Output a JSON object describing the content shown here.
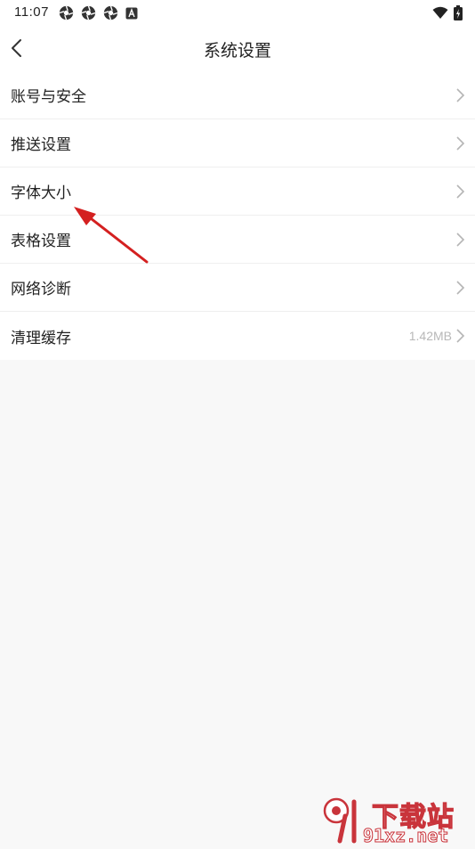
{
  "status_bar": {
    "time": "11:07",
    "left_icons": [
      "aperture-icon",
      "aperture-icon",
      "aperture-icon",
      "keyboard-a-icon"
    ],
    "right_icons": [
      "wifi-icon",
      "battery-charging-icon"
    ]
  },
  "header": {
    "title": "系统设置",
    "back_icon": "back-chevron-icon"
  },
  "menu": {
    "items": [
      {
        "label": "账号与安全",
        "value": ""
      },
      {
        "label": "推送设置",
        "value": ""
      },
      {
        "label": "字体大小",
        "value": ""
      },
      {
        "label": "表格设置",
        "value": ""
      },
      {
        "label": "网络诊断",
        "value": ""
      },
      {
        "label": "清理缓存",
        "value": "1.42MB"
      }
    ]
  },
  "watermark": {
    "text": "下载站",
    "domain": "91xz.net"
  },
  "colors": {
    "background": "#f8f8f8",
    "surface": "#ffffff",
    "annotation_arrow": "#d42020",
    "watermark": "#c9343b"
  }
}
